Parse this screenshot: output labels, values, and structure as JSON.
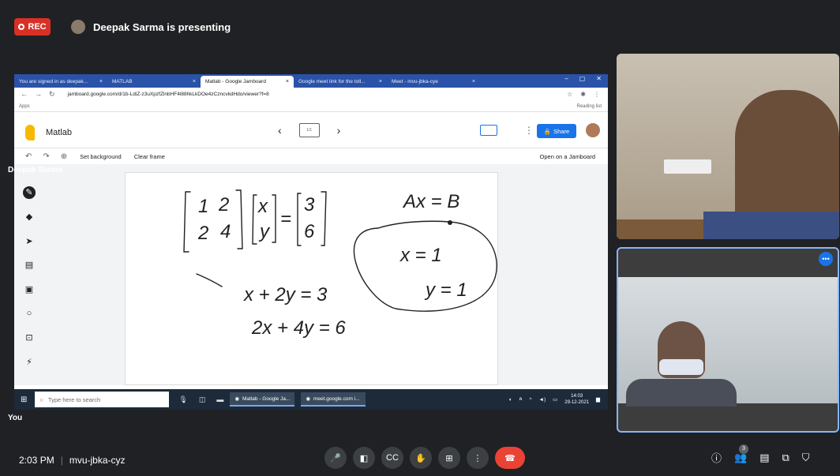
{
  "meet": {
    "rec_label": "REC",
    "presenting_text": "Deepak Sarma is presenting",
    "time": "2:03 PM",
    "meeting_code": "mvu-jbka-cyz",
    "people_count": "3",
    "participants": [
      {
        "name": "Deepak Sarma"
      },
      {
        "name": "You"
      }
    ]
  },
  "browser": {
    "tabs": [
      {
        "label": "You are signed in as deepak...",
        "active": false
      },
      {
        "label": "MATLAB",
        "active": false
      },
      {
        "label": "Matlab - Google Jamboard",
        "active": true
      },
      {
        "label": "Google meet link for the toll...",
        "active": false
      },
      {
        "label": "Meet - mvu-jbka-cye",
        "active": false
      }
    ],
    "url": "jamboard.google.com/d/1b-LdiZ-z3uXpzfZlnbHF4l88hkLkDOe4zCzncvkdHdo/viewer?f=8",
    "apps_label": "Apps",
    "reading_list_label": "Reading list"
  },
  "jamboard": {
    "title": "Matlab",
    "frame_thumb_label": "1/1",
    "share_label": "Share",
    "toolbar": {
      "set_background": "Set background",
      "clear_frame": "Clear frame",
      "open_on_jamboard": "Open on a Jamboard"
    },
    "handwriting": {
      "matrix_a": [
        "1",
        "2",
        "2",
        "4"
      ],
      "vector_x": [
        "x",
        "y"
      ],
      "vector_b": [
        "3",
        "6"
      ],
      "equation_system": "Ax = B",
      "eq1": "x + 2y = 3",
      "eq2": "2x + 4y = 6",
      "solution": [
        "x = 1",
        "y = 1"
      ]
    }
  },
  "taskbar": {
    "search_placeholder": "Type here to search",
    "apps": [
      {
        "label": "Matlab - Google Ja..."
      },
      {
        "label": "meet.google.com i..."
      }
    ],
    "clock_time": "14:03",
    "clock_date": "29-12-2021"
  },
  "icons": {
    "rec": "record-dot-icon",
    "mic": "mic-icon",
    "camera": "camera-icon",
    "captions": "captions-icon",
    "raise_hand": "raise-hand-icon",
    "present": "present-icon",
    "more": "more-vert-icon",
    "end_call": "end-call-icon"
  },
  "colors": {
    "meet_bg": "#202124",
    "rec_red": "#d93025",
    "end_call_red": "#ea4335",
    "jam_blue": "#1a73e8",
    "chrome_tab_bar": "#2a52a8",
    "active_tile_border": "#8ab4f8"
  }
}
